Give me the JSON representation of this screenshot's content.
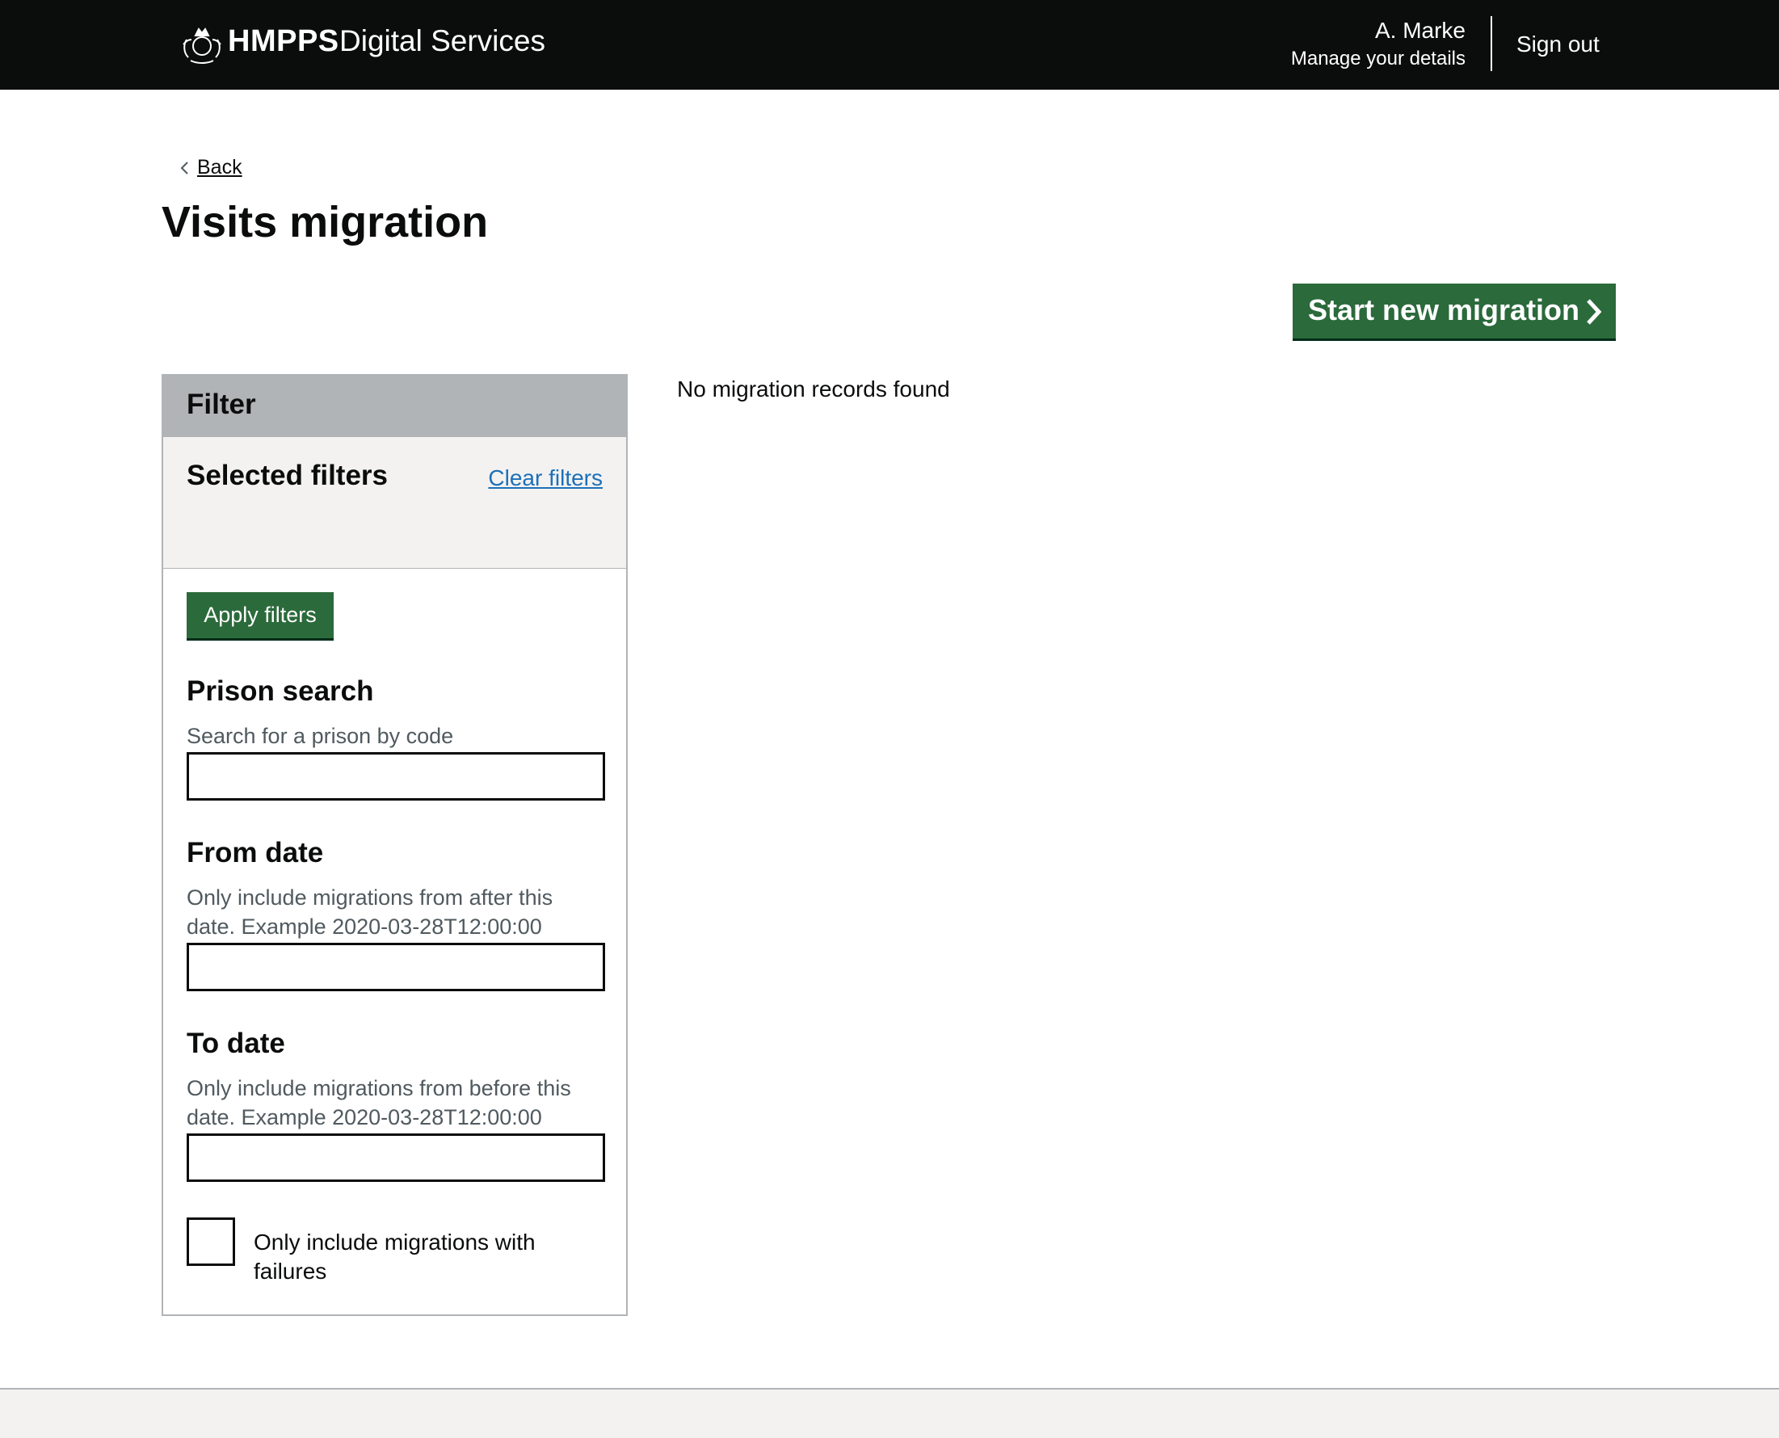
{
  "header": {
    "brand_strong": "HMPPS",
    "brand_light": "Digital Services",
    "user_name": "A. Marke",
    "manage_details": "Manage your details",
    "sign_out": "Sign out",
    "crest_icon": "royal-crest-icon"
  },
  "nav": {
    "back_label": "Back"
  },
  "page": {
    "title": "Visits migration",
    "start_button": "Start new migration",
    "no_records": "No migration records found"
  },
  "filter": {
    "heading": "Filter",
    "selected_heading": "Selected filters",
    "clear_link": "Clear filters",
    "apply_button": "Apply filters",
    "prison": {
      "title": "Prison search",
      "hint": "Search for a prison by code",
      "value": ""
    },
    "from_date": {
      "title": "From date",
      "hint": "Only include migrations from after this date. Example 2020-03-28T12:00:00",
      "value": ""
    },
    "to_date": {
      "title": "To date",
      "hint": "Only include migrations from before this date. Example 2020-03-28T12:00:00",
      "value": ""
    },
    "failures_checkbox": {
      "label": "Only include migrations with failures",
      "checked": false
    }
  },
  "colors": {
    "header_bg": "#0b0c0c",
    "button_green": "#2b6a3b",
    "link_blue": "#1d70b8",
    "filter_head_bg": "#b1b4b6",
    "selected_bg": "#f3f2f1"
  }
}
